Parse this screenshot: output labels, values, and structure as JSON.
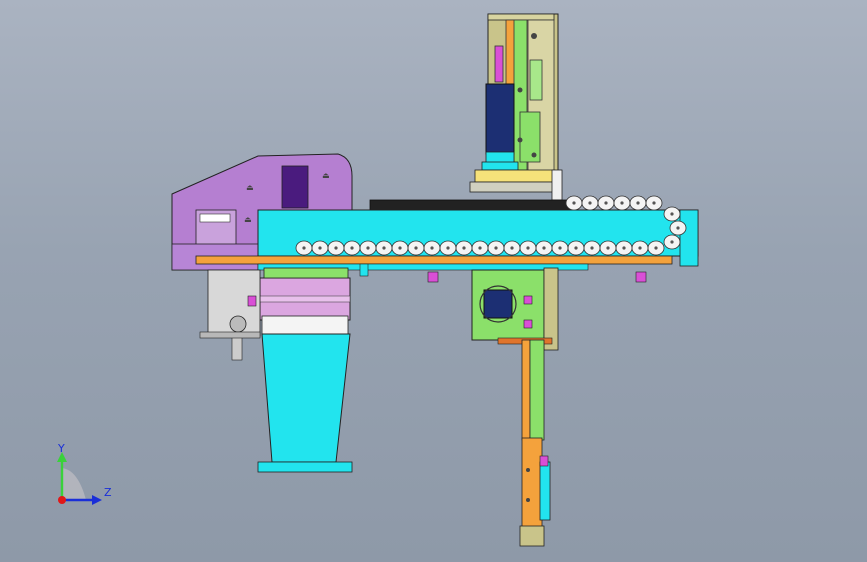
{
  "viewport": {
    "background_top": "#aab3c1",
    "background_bottom": "#8e99a8"
  },
  "colors": {
    "cyan": "#22e4ee",
    "purple": "#b57fd1",
    "orange": "#f4a23c",
    "green": "#8be06a",
    "khaki": "#c9c48a",
    "dark_blue": "#1c2f73",
    "magenta": "#d94fd6",
    "pink": "#dba6e0",
    "white": "#f4f4f4",
    "dark": "#2a2a2a"
  },
  "triad": {
    "y_label": "Y",
    "z_label": "Z",
    "y_color": "#3ad13a",
    "z_color": "#1a2fd8",
    "origin_color": "#e01818"
  }
}
